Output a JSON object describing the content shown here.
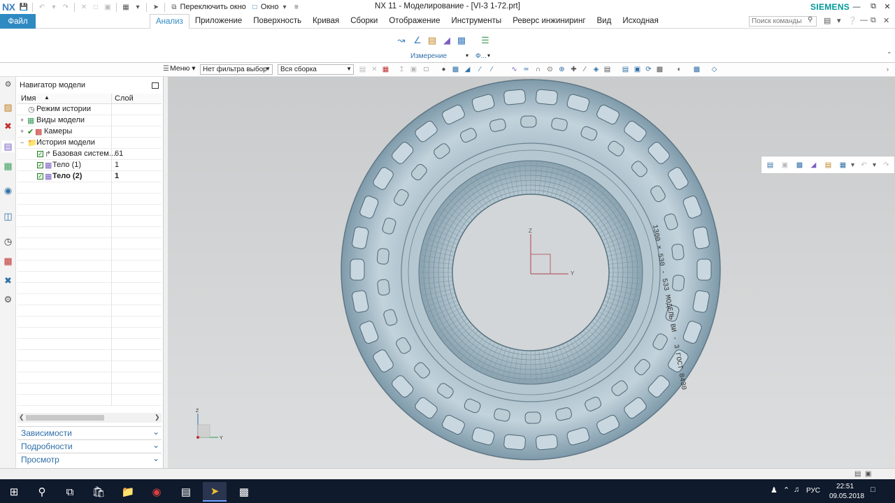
{
  "titlebar": {
    "logo": "NX",
    "switch_window": "Переключить окно",
    "window_menu": "Окно",
    "title": "NX 11 - Моделирование - [VI-3 1-72.prt]",
    "brand": "SIEMENS"
  },
  "ribbon": {
    "file": "Файл",
    "tabs": [
      "Анализ",
      "Приложение",
      "Поверхность",
      "Кривая",
      "Сборки",
      "Отображение",
      "Инструменты",
      "Реверс инжиниринг",
      "Вид",
      "Исходная"
    ],
    "search_placeholder": "Поиск команды",
    "group_label": "Измерение",
    "group_label2": "Ф..."
  },
  "selection_bar": {
    "menu": "Меню",
    "filter": "Нет фильтра выбор",
    "scope": "Вся сборка"
  },
  "navigator": {
    "title": "Навигатор модели",
    "col_name": "Имя",
    "col_layer": "Слой",
    "rows": [
      {
        "label": "Режим истории",
        "layer": ""
      },
      {
        "label": "Виды модели",
        "layer": ""
      },
      {
        "label": "Камеры",
        "layer": ""
      },
      {
        "label": "История модели",
        "layer": ""
      },
      {
        "label": "Базовая систем...",
        "layer": "61"
      },
      {
        "label": "Тело (1)",
        "layer": "1"
      },
      {
        "label": "Тело (2)",
        "layer": "1"
      }
    ],
    "sections": [
      "Зависимости",
      "Подробности",
      "Просмотр"
    ]
  },
  "viewport": {
    "axis_z": "Z",
    "axis_y": "Y",
    "tire_text": "1300 × 530 - 533  МОДЕЛЬ ВИ - 3  ГОСТ 8430"
  },
  "taskbar": {
    "lang": "РУС",
    "time": "22:51",
    "date": "09.05.2018"
  }
}
